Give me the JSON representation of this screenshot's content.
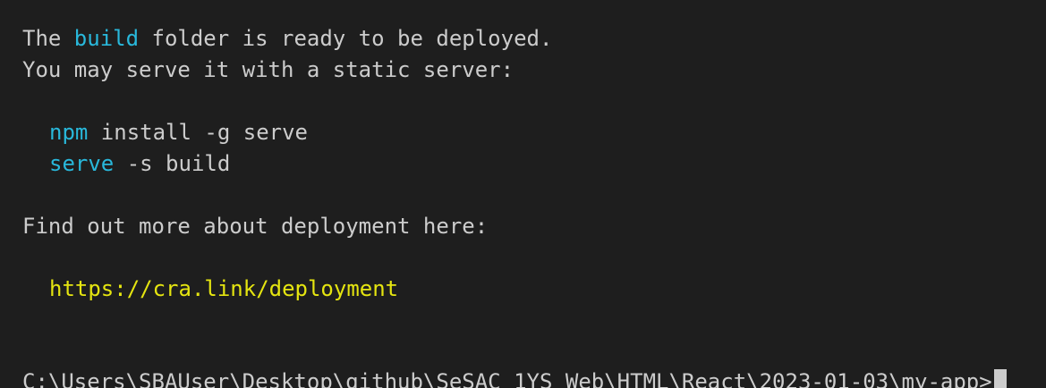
{
  "colors": {
    "background": "#1e1e1e",
    "text": "#cccccc",
    "highlight_cyan": "#29b8db",
    "link_yellow": "#e5e510"
  },
  "terminal": {
    "line1": {
      "prefix": "The ",
      "highlight": "build",
      "suffix": " folder is ready to be deployed."
    },
    "line2": "You may serve it with a static server:",
    "cmd1": {
      "command": "npm",
      "args": " install -g serve"
    },
    "cmd2": {
      "command": "serve",
      "args": " -s build"
    },
    "line3": "Find out more about deployment here:",
    "link": "https://cra.link/deployment",
    "prompt": "C:\\Users\\SBAUser\\Desktop\\github\\SeSAC_1YS_Web\\HTML\\React\\2023-01-03\\my-app>"
  }
}
